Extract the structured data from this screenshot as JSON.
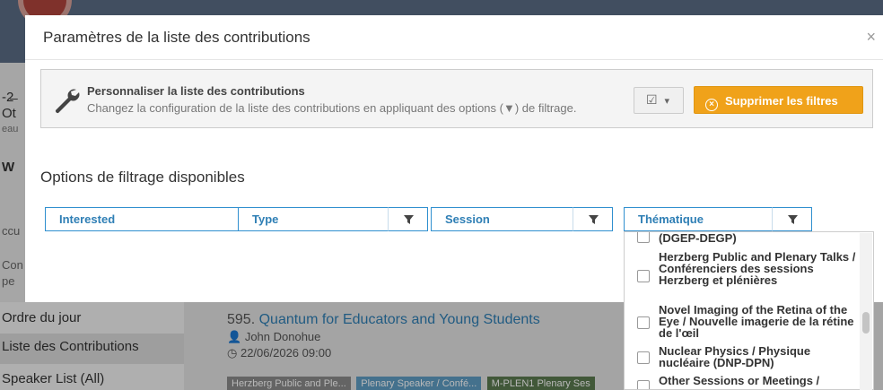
{
  "background": {
    "snippets": [
      "-2̶",
      "Ot",
      "eau",
      "W",
      "ccu",
      "Con",
      "pe"
    ],
    "sidebar": [
      {
        "label": "Ordre du jour",
        "active": false
      },
      {
        "label": "Liste des Contributions",
        "active": true
      },
      {
        "label": "Speaker List (All)",
        "active": false
      }
    ],
    "contribution": {
      "number": "595.",
      "title": "Quantum for Educators and Young Students",
      "speaker": "John Donohue",
      "date": "22/06/2026 09:00",
      "tags": [
        {
          "label": "Herzberg Public and Ple...",
          "color": "#8b8b8b"
        },
        {
          "label": "Plenary Speaker / Confé...",
          "color": "#5f9dc4"
        },
        {
          "label": "M-PLEN1 Plenary Ses",
          "color": "#5b7a4f"
        }
      ]
    }
  },
  "modal": {
    "title": "Paramètres de la liste des contributions",
    "close": "×",
    "info": {
      "title": "Personnaliser la liste des contributions",
      "description": "Changez la configuration de la liste des contributions en appliquant des options (▼) de filtrage.",
      "select_icon": "☑",
      "select_caret": "▾",
      "clear_label": "Supprimer les filtres",
      "clear_icon": "×"
    },
    "section_title": "Options de filtrage disponibles",
    "filters": [
      "Interested",
      "Type",
      "Session",
      "Thématique"
    ],
    "dropdown": {
      "items": [
        {
          "text": "(DGEP-DEGP)",
          "checked": false,
          "show_check": false
        },
        {
          "text": "Herzberg Public and Plenary Talks / Conférenciers des sessions Herzberg et plénières",
          "checked": false,
          "show_check": true
        },
        {
          "text": "Novel Imaging of the Retina of the Eye / Nouvelle imagerie de la rétine de l'œil",
          "checked": false,
          "show_check": true
        },
        {
          "text": "Nuclear Physics / Physique nucléaire (DNP-DPN)",
          "checked": false,
          "show_check": true
        },
        {
          "text": "Other Sessions or Meetings /",
          "checked": false,
          "show_check": true
        }
      ]
    }
  },
  "colors": {
    "accent": "#2f8fcf",
    "warning": "#f0a21a"
  }
}
